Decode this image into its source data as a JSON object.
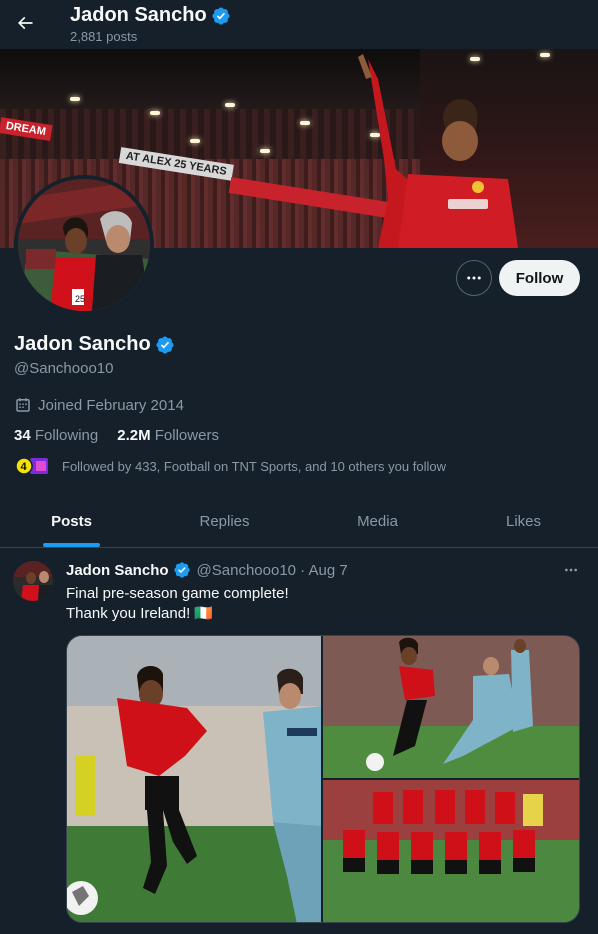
{
  "header": {
    "title": "Jadon Sancho",
    "post_count": "2,881 posts"
  },
  "banner": {
    "board_text_1": "DREAM",
    "board_text_2": "AT ALEX 25 YEARS"
  },
  "profile": {
    "name": "Jadon Sancho",
    "handle": "@Sanchooo10",
    "joined": "Joined February 2014",
    "following_count": "34",
    "following_label": "Following",
    "followers_count": "2.2M",
    "followers_label": "Followers",
    "followed_by": "Followed by 433, Football on TNT Sports, and 10 others you follow",
    "follow_button": "Follow"
  },
  "tabs": [
    {
      "label": "Posts",
      "active": true
    },
    {
      "label": "Replies",
      "active": false
    },
    {
      "label": "Media",
      "active": false
    },
    {
      "label": "Likes",
      "active": false
    }
  ],
  "tweet": {
    "name": "Jadon Sancho",
    "handle_time": "@Sanchooo10 · Aug 7",
    "line1": "Final pre-season game complete!",
    "line2": "Thank you Ireland! 🇮🇪"
  },
  "colors": {
    "background": "#15202b",
    "accent": "#1d9bf0",
    "verified": "#1d9bf0",
    "muted_text": "#8b98a5"
  },
  "icons": {
    "back": "arrow-left-icon",
    "verified": "verified-badge-icon",
    "calendar": "calendar-icon",
    "more": "more-dots-icon"
  }
}
